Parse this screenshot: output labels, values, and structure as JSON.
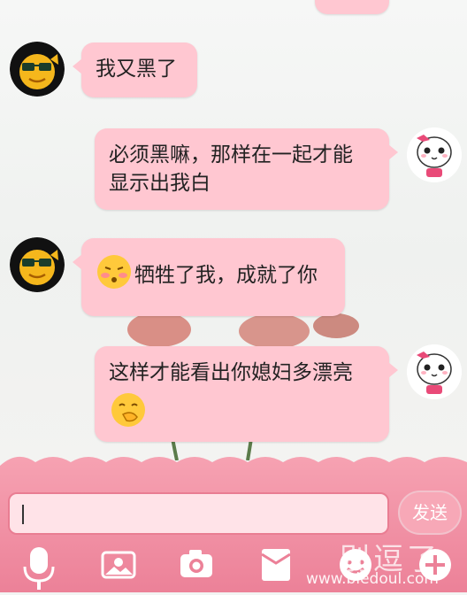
{
  "messages": [
    {
      "side": "left",
      "text": "我又黑了"
    },
    {
      "side": "right",
      "text_line1": "必须黑嘛，那样在一起才能",
      "text_line2": "显示出我白"
    },
    {
      "side": "left",
      "text": "牺牲了我，成就了你",
      "emoji": "blushing-face"
    },
    {
      "side": "right",
      "text": "这样才能看出你媳妇多漂亮",
      "emoji": "hand-over-mouth-face"
    }
  ],
  "input": {
    "value": "",
    "placeholder": ""
  },
  "send_button": {
    "label": "发送"
  },
  "toolbar": {
    "items": [
      "microphone-icon",
      "photo-icon",
      "camera-icon",
      "card-icon",
      "emoji-icon",
      "plus-icon"
    ]
  },
  "watermark": {
    "title": "别逗了",
    "url": "www.biedoul.com"
  },
  "colors": {
    "bubble": "#ffc7d1",
    "bar": "#f08aa0",
    "send": "#f7a8b7"
  }
}
